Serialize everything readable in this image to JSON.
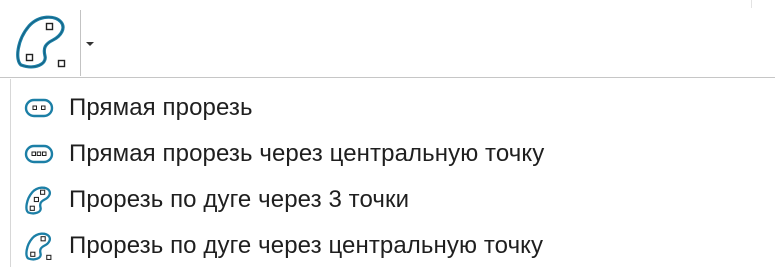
{
  "toolbar": {
    "active_tool_icon": "arc-slot-icon",
    "dropdown_icon": "chevron-down-icon"
  },
  "menu": {
    "items": [
      {
        "label": "Прямая прорезь",
        "icon": "straight-slot-icon"
      },
      {
        "label": "Прямая прорезь через центральную точку",
        "icon": "straight-slot-center-icon"
      },
      {
        "label": "Прорезь по дуге через 3 точки",
        "icon": "arc-slot-3pt-icon"
      },
      {
        "label": "Прорезь по дуге через центральную точку",
        "icon": "arc-slot-center-icon"
      }
    ]
  },
  "colors": {
    "icon_stroke": "#1c7fa6",
    "icon_fill": "#ffffff",
    "text": "#1f1f1f",
    "separator": "#c6c6c6"
  }
}
